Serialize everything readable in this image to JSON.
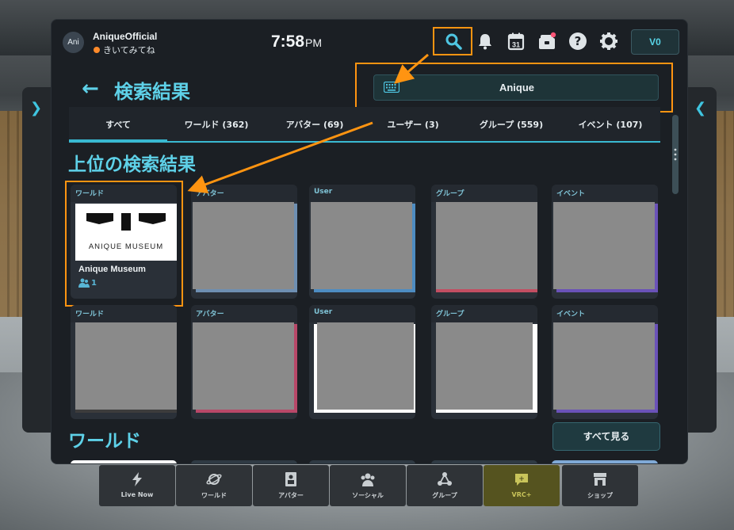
{
  "colors": {
    "accent": "#5ed1e8",
    "highlight": "#ff9411",
    "status_online": "#ff8a2a"
  },
  "user": {
    "avatar_text": "Ani",
    "name": "AniqueOfficial",
    "status": "きいてみてね"
  },
  "clock": {
    "time": "7:58",
    "ampm": "PM"
  },
  "topbar": {
    "icons": [
      "search-icon",
      "bell-icon",
      "calendar-icon",
      "inventory-icon",
      "help-icon",
      "gear-icon"
    ],
    "calendar_day": "31",
    "balance": "V0"
  },
  "header": {
    "title": "検索結果"
  },
  "search": {
    "value": "Anique"
  },
  "tabs": [
    {
      "label": "すべて",
      "active": true
    },
    {
      "label": "ワールド (362)"
    },
    {
      "label": "アバター (69)"
    },
    {
      "label": "ユーザー (3)"
    },
    {
      "label": "グループ (559)"
    },
    {
      "label": "イベント (107)"
    }
  ],
  "sections": {
    "top_results": "上位の検索結果",
    "worlds": "ワールド",
    "see_all": "すべて見る"
  },
  "row1": [
    {
      "type": "ワールド",
      "name": "Anique Museum",
      "count": "1",
      "logo_text": "ANIQUE MUSEUM"
    },
    {
      "type": "アバター"
    },
    {
      "type": "User"
    },
    {
      "type": "グループ"
    },
    {
      "type": "イベント"
    }
  ],
  "row2": [
    {
      "type": "ワールド"
    },
    {
      "type": "アバター"
    },
    {
      "type": "User"
    },
    {
      "type": "グループ"
    },
    {
      "type": "イベント"
    }
  ],
  "dock": [
    {
      "label": "Live Now",
      "icon": "lightning-icon"
    },
    {
      "label": "ワールド",
      "icon": "planet-icon"
    },
    {
      "label": "アバター",
      "icon": "avatar-icon"
    },
    {
      "label": "ソーシャル",
      "icon": "social-icon"
    },
    {
      "label": "グループ",
      "icon": "group-icon"
    },
    {
      "label": "VRC+",
      "icon": "vrcplus-icon"
    },
    {
      "label": "ショップ",
      "icon": "shop-icon"
    }
  ]
}
